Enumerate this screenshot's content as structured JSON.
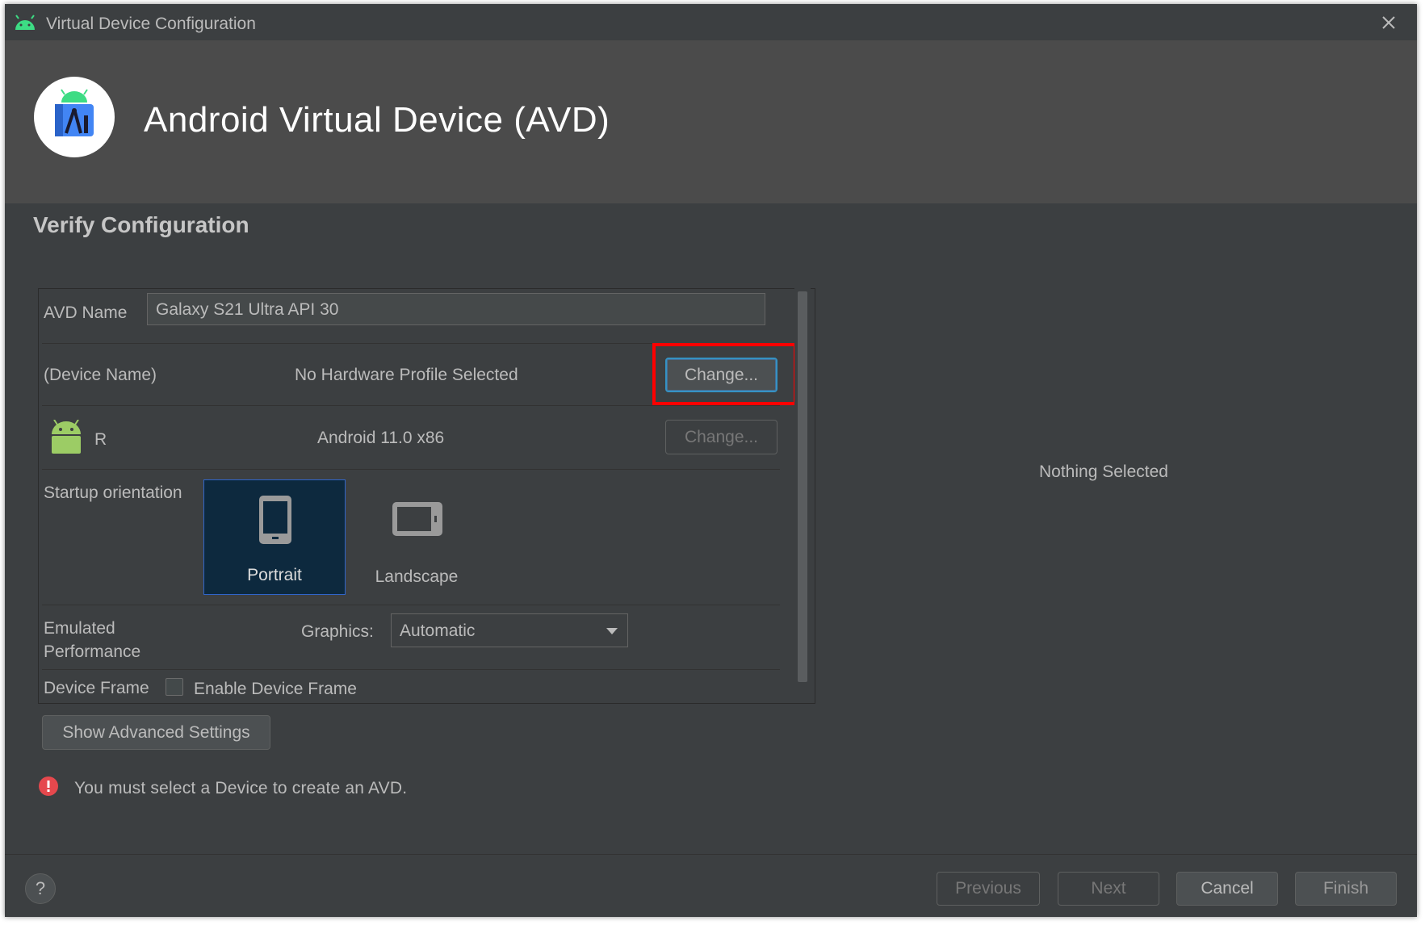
{
  "window": {
    "title": "Virtual Device Configuration",
    "banner_title": "Android Virtual Device (AVD)"
  },
  "section_title": "Verify Configuration",
  "avd_name": {
    "label": "AVD Name",
    "value": "Galaxy S21 Ultra API 30"
  },
  "device": {
    "label": "(Device Name)",
    "value": "No Hardware Profile Selected",
    "change_label": "Change..."
  },
  "system_image": {
    "label": "R",
    "value": "Android 11.0 x86",
    "change_label": "Change..."
  },
  "orientation": {
    "label": "Startup orientation",
    "options": [
      "Portrait",
      "Landscape"
    ],
    "selected": "Portrait"
  },
  "performance": {
    "label_line1": "Emulated",
    "label_line2": "Performance",
    "graphics_label": "Graphics:",
    "graphics_value": "Automatic"
  },
  "device_frame": {
    "label": "Device Frame",
    "checkbox_label": "Enable Device Frame",
    "checked": false
  },
  "advanced_button": "Show Advanced Settings",
  "right_panel": {
    "message": "Nothing Selected"
  },
  "error": {
    "message": "You must select a Device to create an AVD."
  },
  "footer": {
    "help": "?",
    "previous": "Previous",
    "next": "Next",
    "cancel": "Cancel",
    "finish": "Finish"
  },
  "colors": {
    "background": "#3c3f41",
    "banner": "#4b4b4b",
    "focus_blue": "#3592c4",
    "highlight_red": "#ff0000",
    "error_red": "#e5484d",
    "android_green": "#9ccc65"
  }
}
